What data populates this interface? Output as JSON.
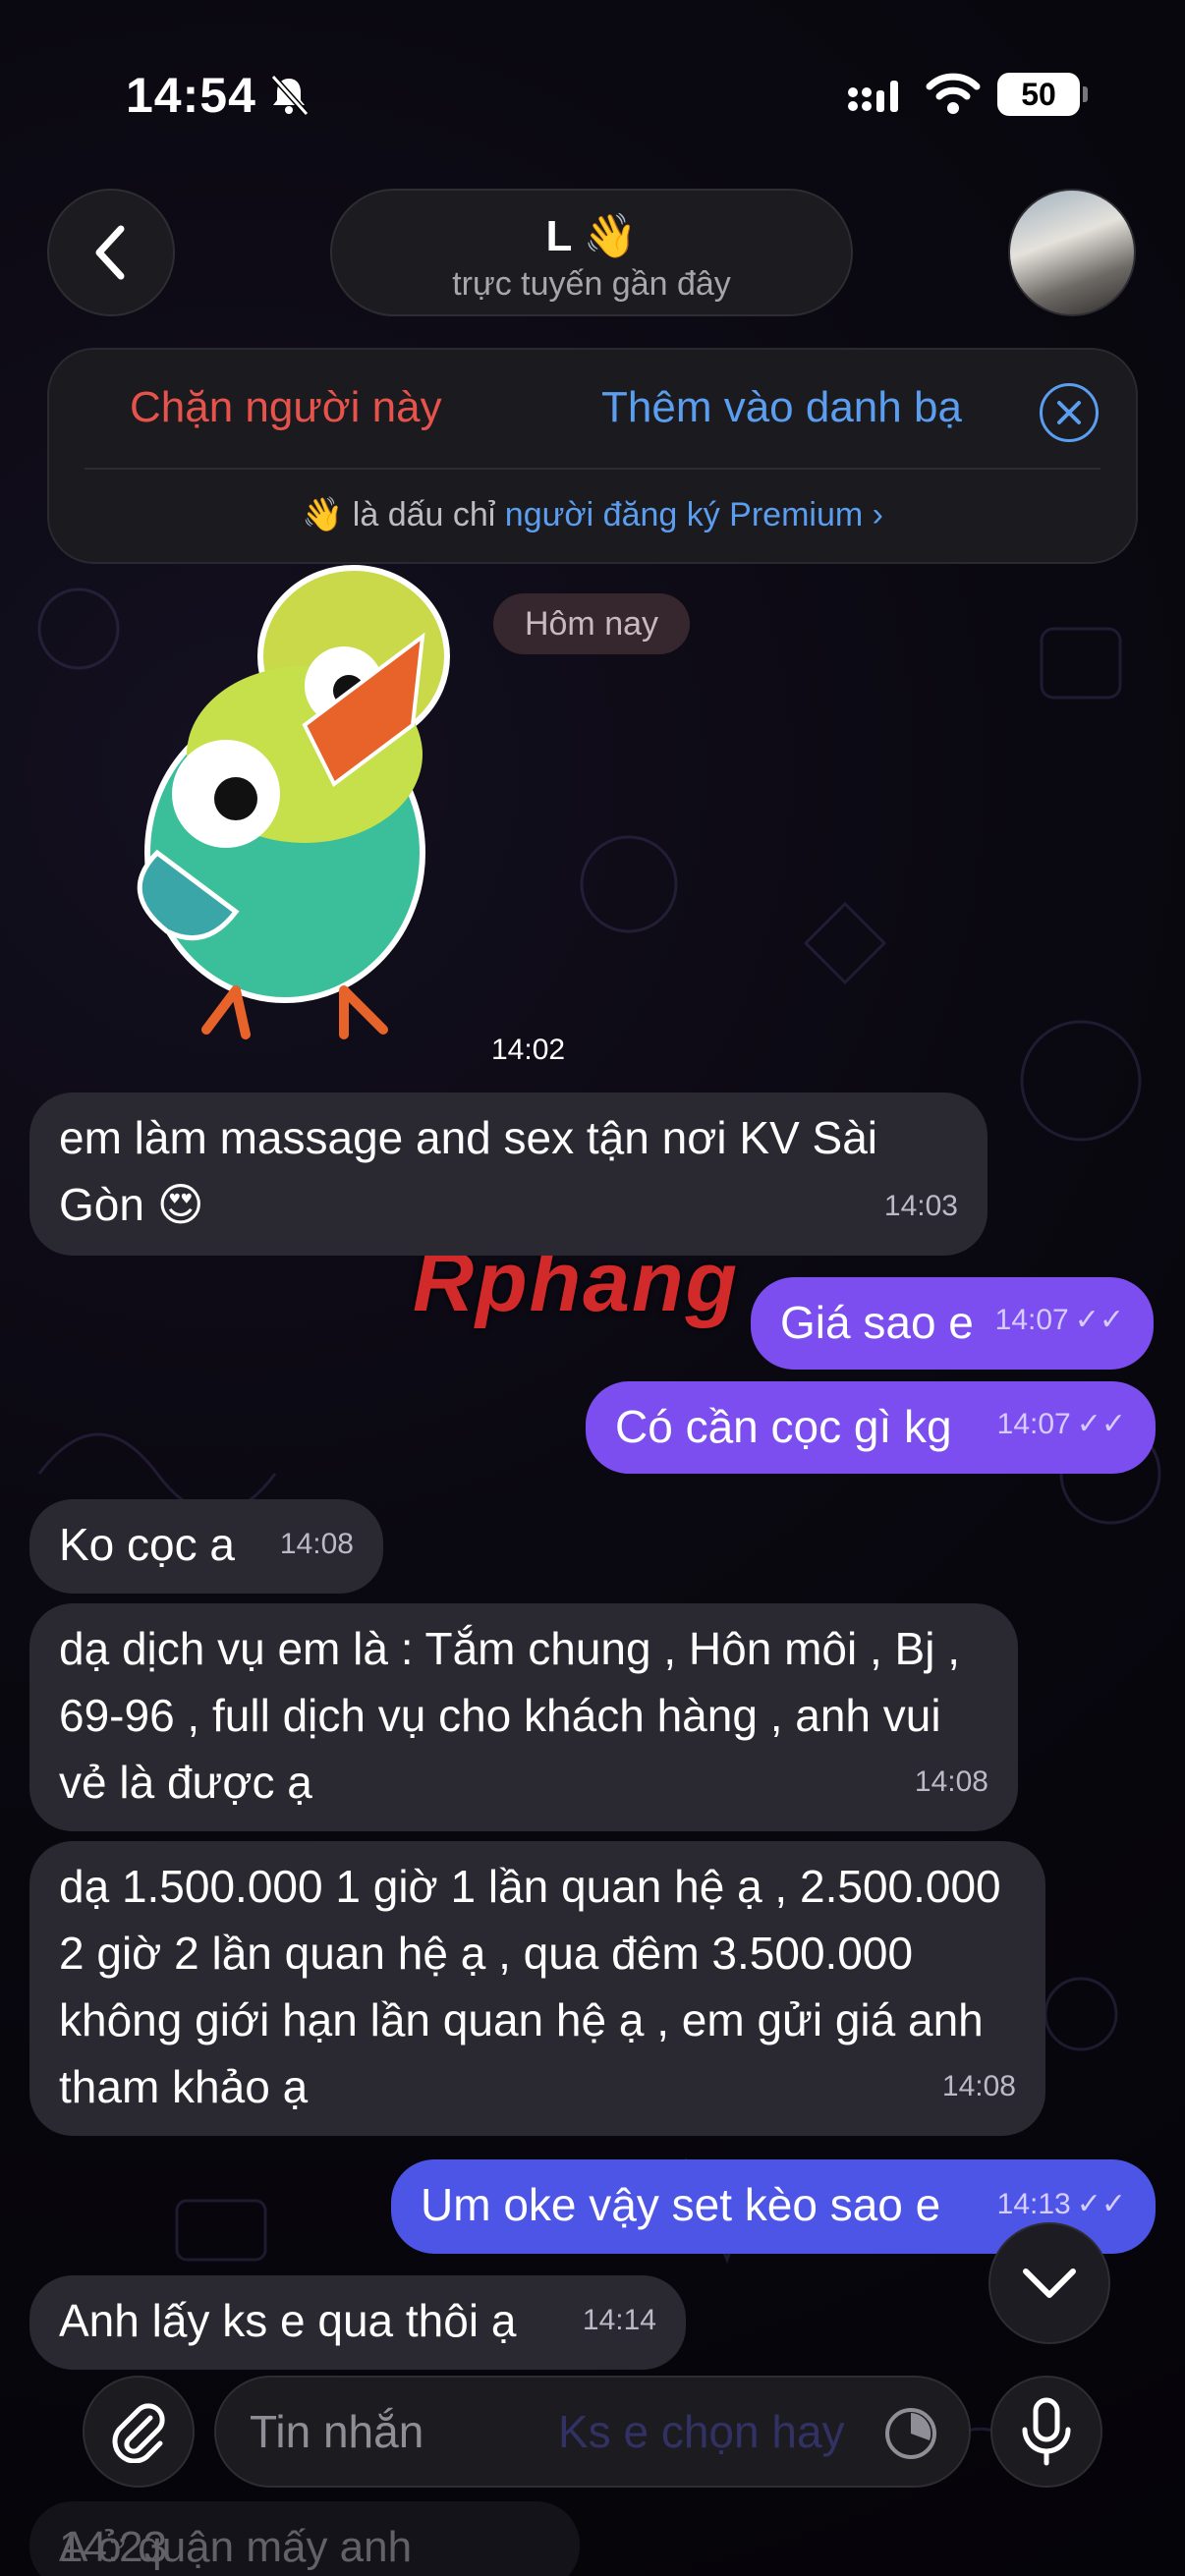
{
  "status_bar": {
    "time": "14:54",
    "battery": "50"
  },
  "header": {
    "title": "L 👋",
    "subtitle": "trực tuyến gần đây"
  },
  "action_panel": {
    "block_label": "Chặn người này",
    "add_contact_label": "Thêm vào danh bạ",
    "premium_prefix": "👋 là dấu chỉ ",
    "premium_link": "người đăng ký Premium",
    "premium_chevron": "›"
  },
  "chat": {
    "date_chip": "Hôm nay",
    "sticker_time": "14:02",
    "watermark": "Rphang",
    "messages": [
      {
        "dir": "in",
        "text": "em làm massage and sex tận nơi KV Sài Gòn 😍",
        "time": "14:03"
      },
      {
        "dir": "out",
        "text": "Giá sao e",
        "time": "14:07"
      },
      {
        "dir": "out",
        "text": "Có cần cọc gì kg",
        "time": "14:07"
      },
      {
        "dir": "in",
        "text": "Ko cọc a",
        "time": "14:08"
      },
      {
        "dir": "in",
        "text": "dạ dịch vụ  em là : Tắm chung , Hôn môi , Bj , 69-96 , full dịch vụ cho khách hàng , anh vui vẻ là được ạ",
        "time": "14:08"
      },
      {
        "dir": "in",
        "text": "dạ 1.500.000 1 giờ 1 lần quan hệ ạ , 2.500.000 2 giờ 2 lần quan hệ ạ , qua đêm 3.500.000 không giới hạn lần quan hệ ạ , em gửi giá anh tham khảo ạ",
        "time": "14:08"
      },
      {
        "dir": "out",
        "text": "Um oke vậy set kèo sao e",
        "time": "14:13"
      },
      {
        "dir": "in",
        "text": "Anh lấy ks e qua thôi ạ",
        "time": "14:14"
      },
      {
        "dir": "in",
        "text": "A ở quận mấy anh",
        "time": "14:23"
      }
    ],
    "read_ticks": "✓✓"
  },
  "composer": {
    "placeholder": "Tin nhắn",
    "ghost_text": "Ks e chọn hay"
  }
}
